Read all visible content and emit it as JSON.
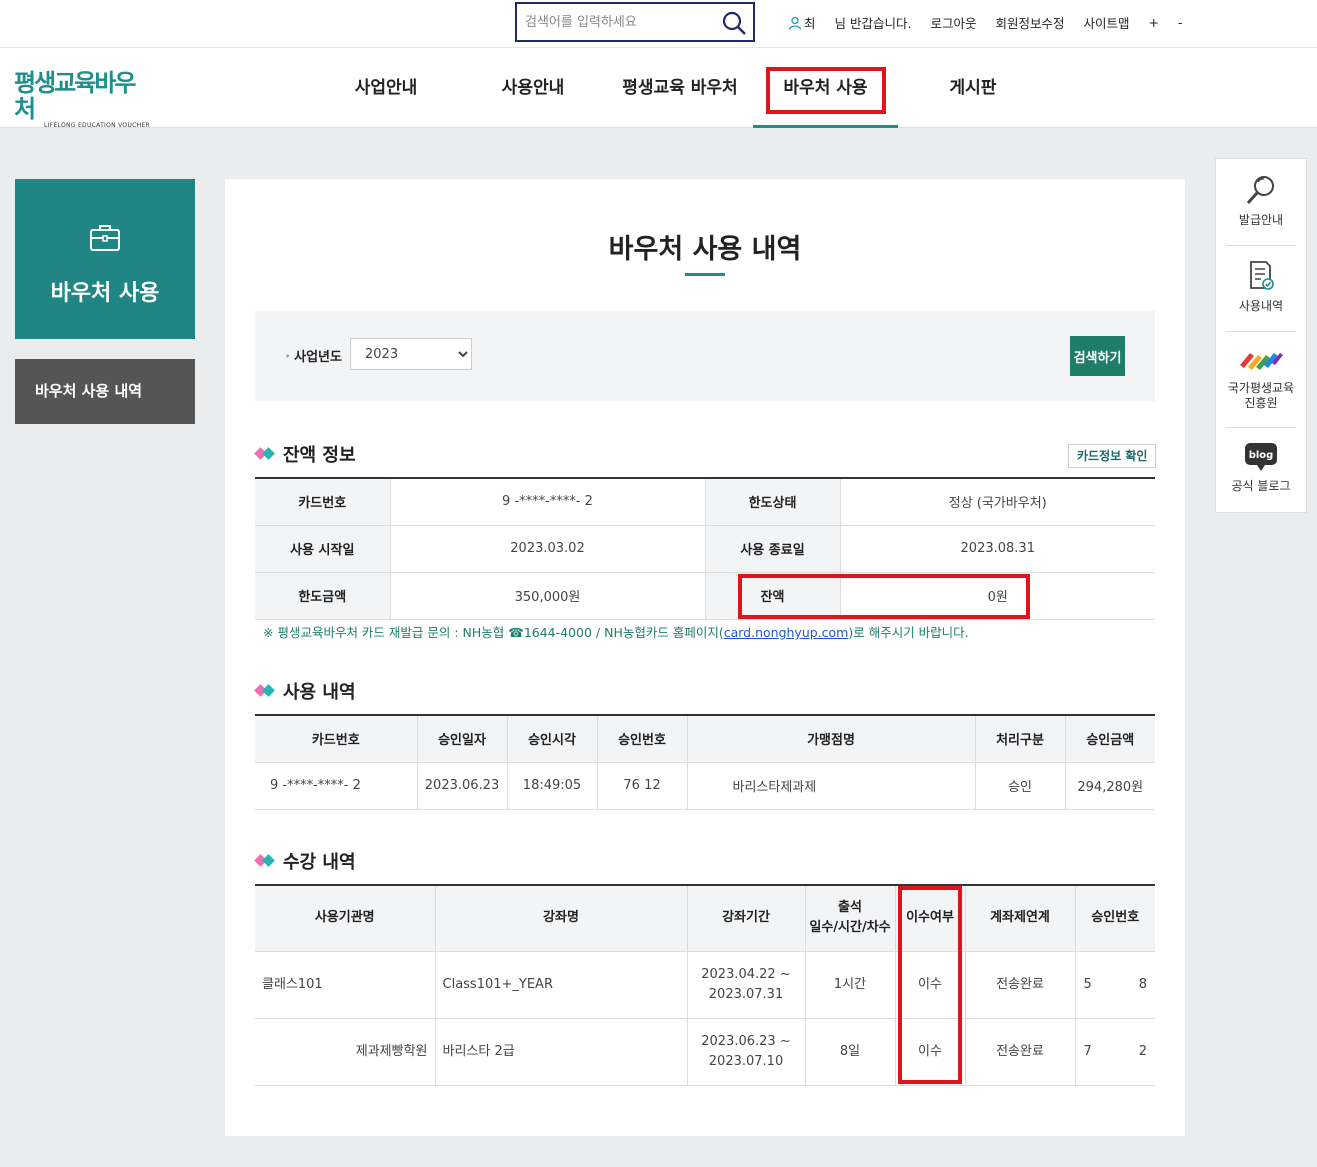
{
  "header": {
    "search_placeholder": "검색어를 입력하세요",
    "user_name": "최",
    "greeting": "님 반갑습니다.",
    "links": [
      "로그아웃",
      "회원정보수정",
      "사이트맵",
      "+",
      "-"
    ]
  },
  "logo": {
    "text": "평생교육바우처",
    "subtext": "LIFELONG EDUCATION VOUCHER"
  },
  "nav": {
    "items": [
      "사업안내",
      "사용안내",
      "평생교육 바우처",
      "바우처 사용",
      "게시판"
    ],
    "active": "바우처 사용"
  },
  "sidebar": {
    "title": "바우처 사용",
    "sub_item": "바우처 사용 내역"
  },
  "page": {
    "title": "바우처 사용 내역"
  },
  "filter": {
    "label": "사업년도",
    "year_value": "2023",
    "search_button": "검색하기"
  },
  "balance": {
    "heading": "잔액 정보",
    "card_info_button": "카드정보 확인",
    "rows": [
      {
        "label1": "카드번호",
        "value1": "9        -****-****-        2",
        "label2": "한도상태",
        "value2": "정상 (국가바우처)"
      },
      {
        "label1": "사용 시작일",
        "value1": "2023.03.02",
        "label2": "사용 종료일",
        "value2": "2023.08.31"
      },
      {
        "label1": "한도금액",
        "value1": "350,000원",
        "label2": "잔액",
        "value2": "0원"
      }
    ],
    "notice_prefix": "※ 평생교육바우처 카드 재발급 문의 : NH농협 ☎1644-4000 / NH농협카드 홈페이지(",
    "notice_link": "card.nonghyup.com",
    "notice_suffix": ")로 해주시기 바랍니다."
  },
  "usage": {
    "heading": "사용 내역",
    "columns": [
      "카드번호",
      "승인일자",
      "승인시각",
      "승인번호",
      "가맹점명",
      "처리구분",
      "승인금액"
    ],
    "rows": [
      [
        "9      -****-****-     2",
        "2023.06.23",
        "18:49:05",
        "76    12",
        "바리스타제과제",
        "승인",
        "294,280원"
      ]
    ]
  },
  "courses": {
    "heading": "수강 내역",
    "columns": [
      "사용기관명",
      "강좌명",
      "강좌기간",
      "출석\n일수/시간/차수",
      "이수여부",
      "계좌제연계",
      "승인번호"
    ],
    "col_attend_line1": "출석",
    "col_attend_line2": "일수/시간/차수",
    "rows": [
      {
        "org": "클래스101",
        "course": "Class101+_YEAR",
        "period1": "2023.04.22 ~",
        "period2": "2023.07.31",
        "attend": "1시간",
        "completed": "이수",
        "link": "전송완료",
        "approval_a": "5",
        "approval_b": "8"
      },
      {
        "org": "제과제빵학원",
        "course": "바리스타 2급",
        "period1": "2023.06.23 ~",
        "period2": "2023.07.10",
        "attend": "8일",
        "completed": "이수",
        "link": "전송완료",
        "approval_a": "7",
        "approval_b": "2"
      }
    ]
  },
  "quick_menu": {
    "items": [
      "발급안내",
      "사용내역",
      "국가평생교육\n진흥원",
      "공식 블로그"
    ],
    "item_issue": "발급안내",
    "item_history": "사용내역",
    "item_nile_1": "국가평생교육",
    "item_nile_2": "진흥원",
    "item_blog": "공식 블로그",
    "blog_badge": "blog"
  },
  "colors": {
    "accent": "#1d8f8c",
    "sidebar_bg": "#1f8585",
    "button_bg": "#1f7e6a",
    "highlight_box": "#e0141b"
  }
}
